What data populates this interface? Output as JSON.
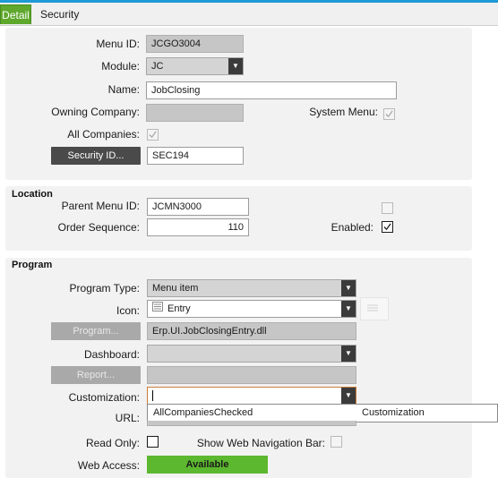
{
  "tabs": [
    {
      "label": "Detail",
      "active": true
    },
    {
      "label": "Security",
      "active": false
    }
  ],
  "general": {
    "menu_id_label": "Menu ID:",
    "menu_id_value": "JCGO3004",
    "module_label": "Module:",
    "module_value": "JC",
    "name_label": "Name:",
    "name_value": "JobClosing",
    "owning_company_label": "Owning Company:",
    "owning_company_value": "",
    "system_menu_label": "System Menu:",
    "system_menu_checked": true,
    "all_companies_label": "All Companies:",
    "all_companies_checked": true,
    "security_id_button": "Security ID...",
    "security_id_value": "SEC194"
  },
  "location": {
    "title": "Location",
    "parent_menu_id_label": "Parent Menu ID:",
    "parent_menu_id_value": "JCMN3000",
    "order_sequence_label": "Order Sequence:",
    "order_sequence_value": "110",
    "enabled_label": "Enabled:",
    "enabled_checked": true,
    "unlabeled_checked": false
  },
  "program": {
    "title": "Program",
    "program_type_label": "Program Type:",
    "program_type_value": "Menu item",
    "icon_label": "Icon:",
    "icon_value": "Entry",
    "program_button": "Program...",
    "program_value": "Erp.UI.JobClosingEntry.dll",
    "dashboard_label": "Dashboard:",
    "dashboard_value": "",
    "report_button": "Report...",
    "report_value": "",
    "customization_label": "Customization:",
    "customization_value": "",
    "customization_dropdown": {
      "col1": "AllCompaniesChecked",
      "col2": "Customization"
    },
    "url_label": "URL:",
    "read_only_label": "Read Only:",
    "read_only_checked": false,
    "show_web_nav_label": "Show Web Navigation Bar:",
    "show_web_nav_checked": false,
    "web_access_label": "Web Access:",
    "web_access_value": "Available"
  },
  "colors": {
    "accent_green": "#5cb82f",
    "top_bar_blue": "#1e9ad6",
    "dark_button": "#4a4a4a",
    "panel_bg": "#f2f2f2"
  }
}
